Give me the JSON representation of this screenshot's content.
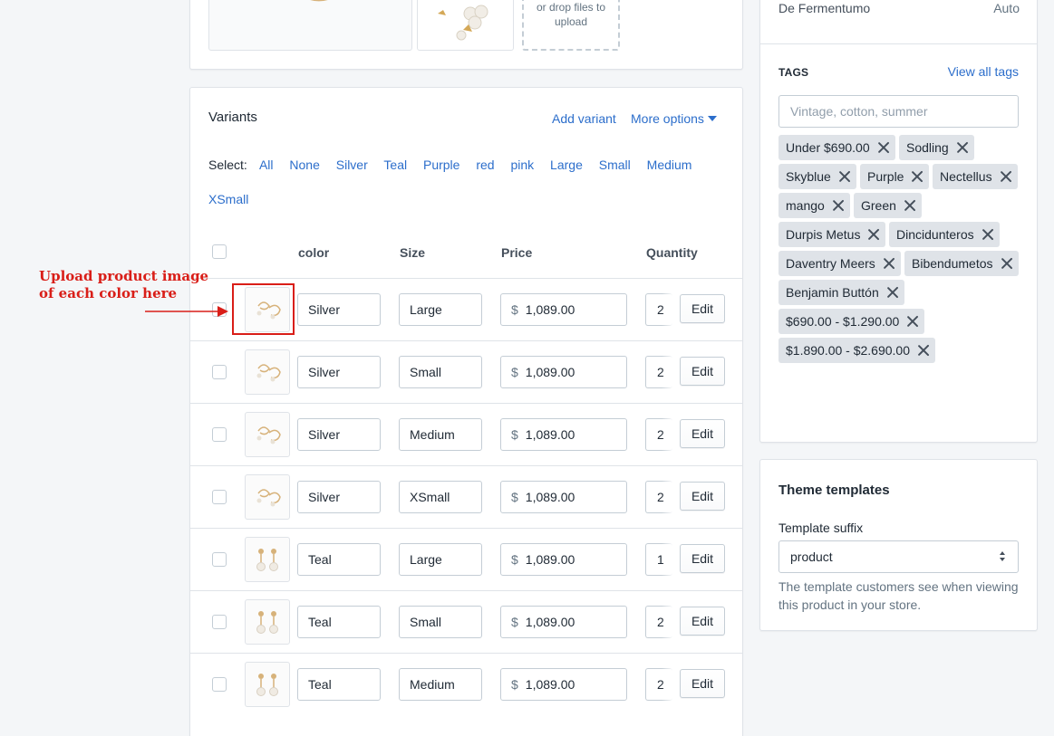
{
  "media": {
    "dropzone_text": "or drop files to upload"
  },
  "variants": {
    "title": "Variants",
    "add_variant": "Add variant",
    "more_options": "More options",
    "select_label": "Select:",
    "select_options": [
      "All",
      "None",
      "Silver",
      "Teal",
      "Purple",
      "red",
      "pink",
      "Large",
      "Small",
      "Medium",
      "XSmall"
    ],
    "columns": {
      "color": "color",
      "size": "Size",
      "price": "Price",
      "quantity": "Quantity"
    },
    "currency": "$",
    "edit_label": "Edit",
    "rows": [
      {
        "color": "Silver",
        "size": "Large",
        "price": "1,089.00",
        "qty": "2",
        "image": "silver-earring-image"
      },
      {
        "color": "Silver",
        "size": "Small",
        "price": "1,089.00",
        "qty": "2",
        "image": "silver-earring-image"
      },
      {
        "color": "Silver",
        "size": "Medium",
        "price": "1,089.00",
        "qty": "2",
        "image": "silver-earring-image"
      },
      {
        "color": "Silver",
        "size": "XSmall",
        "price": "1,089.00",
        "qty": "2",
        "image": "silver-earring-image"
      },
      {
        "color": "Teal",
        "size": "Large",
        "price": "1,089.00",
        "qty": "1",
        "image": "teal-earring-image"
      },
      {
        "color": "Teal",
        "size": "Small",
        "price": "1,089.00",
        "qty": "2",
        "image": "teal-earring-image"
      },
      {
        "color": "Teal",
        "size": "Medium",
        "price": "1,089.00",
        "qty": "2",
        "image": "teal-earring-image"
      }
    ]
  },
  "annotation": {
    "line1": "Upload product image",
    "line2": "of each color here",
    "color": "#d91e18"
  },
  "organization": {
    "vendor": "De Fermentumo",
    "vendor_mode": "Auto",
    "tags_heading": "TAGS",
    "view_all_tags": "View all tags",
    "tags_placeholder": "Vintage, cotton, summer",
    "tags": [
      "Under $690.00",
      "Sodling",
      "Skyblue",
      "Purple",
      "Nectellus",
      "mango",
      "Green",
      "Durpis Metus",
      "Dincidunteros",
      "Daventry Meers",
      "Bibendumetos",
      "Benjamin Buttón",
      "$690.00 - $1.290.00",
      "$1.890.00 - $2.690.00"
    ]
  },
  "theme": {
    "title": "Theme templates",
    "suffix_label": "Template suffix",
    "suffix_value": "product",
    "help_text": "The template customers see when viewing this product in your store."
  },
  "colors": {
    "link": "#2c6ecb",
    "tag_bg": "#dfe3e8",
    "border": "#dfe3e8"
  }
}
